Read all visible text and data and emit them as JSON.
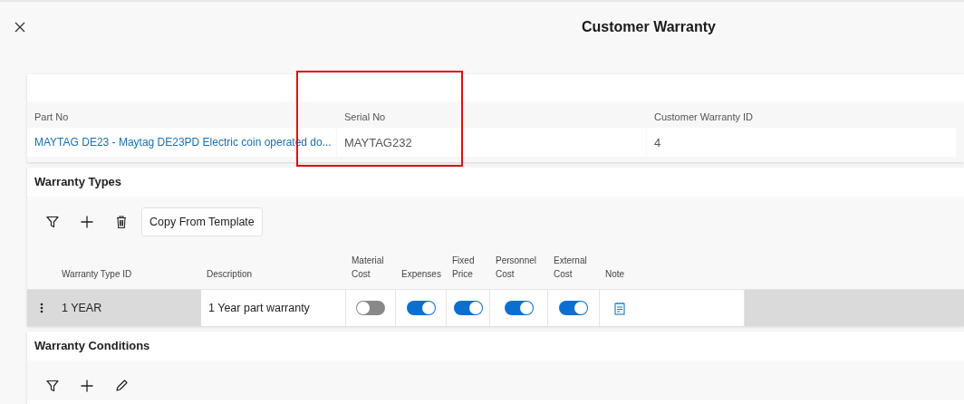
{
  "header": {
    "title": "Customer Warranty"
  },
  "details": {
    "fields": [
      {
        "label": "Part No",
        "value": "MAYTAG DE23 - Maytag DE23PD Electric coin operated do...",
        "kind": "link"
      },
      {
        "label": "Serial No",
        "value": "MAYTAG232",
        "kind": "text"
      },
      {
        "label": "Customer Warranty ID",
        "value": "4",
        "kind": "text"
      }
    ]
  },
  "warranty_types": {
    "title": "Warranty Types",
    "toolbar": [
      {
        "kind": "filter"
      },
      {
        "kind": "add"
      },
      {
        "kind": "delete"
      },
      {
        "kind": "button",
        "label": "Copy From Template"
      }
    ],
    "columns": [
      "Warranty Type ID",
      "Description",
      "Material Cost",
      "Expenses",
      "Fixed Price",
      "Personnel Cost",
      "External Cost",
      "Note"
    ],
    "rows": [
      {
        "id": "1 YEAR",
        "description": "1 Year part warranty",
        "flags": [
          {
            "on": false
          },
          {
            "on": true
          },
          {
            "on": true
          },
          {
            "on": true
          },
          {
            "on": true
          }
        ],
        "note": true
      }
    ]
  },
  "warranty_conditions": {
    "title": "Warranty Conditions",
    "toolbar": [
      {
        "kind": "filter"
      },
      {
        "kind": "add"
      },
      {
        "kind": "edit"
      }
    ]
  }
}
